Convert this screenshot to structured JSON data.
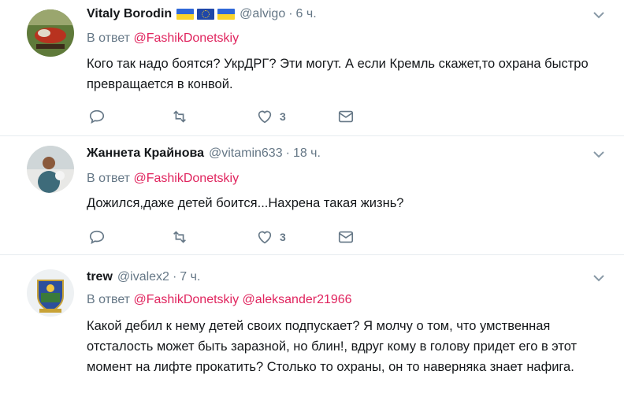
{
  "replies": [
    {
      "name": "Vitaly Borodin",
      "flags": [
        "ua",
        "eu",
        "ua"
      ],
      "handle": "@alvigo",
      "time": "6 ч.",
      "reply_prefix": "В ответ",
      "reply_to": [
        "@FashikDonetskiy"
      ],
      "text": "Кого так надо боятся? УкрДРГ? Эти могут. А если Кремль скажет,то охрана быстро превращается в конвой.",
      "likes": "3"
    },
    {
      "name": "Жаннета Крайнова",
      "flags": [],
      "handle": "@vitamin633",
      "time": "18 ч.",
      "reply_prefix": "В ответ",
      "reply_to": [
        "@FashikDonetskiy"
      ],
      "text": "Дожился,даже детей боится...Нахрена такая жизнь?",
      "likes": "3"
    },
    {
      "name": "trew",
      "flags": [],
      "handle": "@ivalex2",
      "time": "7 ч.",
      "reply_prefix": "В ответ",
      "reply_to": [
        "@FashikDonetskiy",
        "@aleksander21966"
      ],
      "text": "Какой дебил к нему детей своих подпускает? Я молчу о том, что умственная отсталость может быть заразной, но блин!, вдруг кому в голову придет его в этот момент на лифте прокатить? Столько то охраны, он то наверняка знает нафига.",
      "likes": ""
    }
  ],
  "colors": {
    "link": "#e0245e",
    "muted": "#657786",
    "text": "#14171a",
    "border": "#e6ecf0"
  },
  "icons": [
    "reply-icon",
    "retweet-icon",
    "like-icon",
    "dm-icon",
    "caret-down-icon"
  ]
}
